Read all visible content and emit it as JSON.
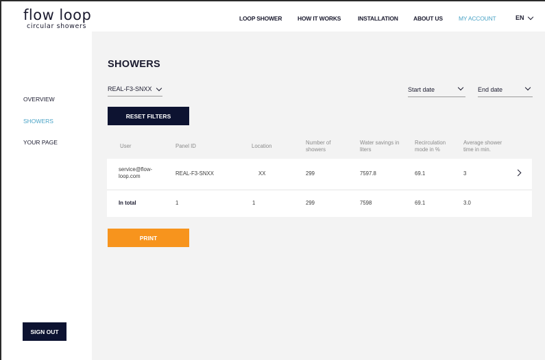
{
  "header": {
    "logo_main": "flow loop",
    "logo_sub": "circular showers",
    "nav": [
      {
        "label": "LOOP SHOWER"
      },
      {
        "label": "HOW IT WORKS"
      },
      {
        "label": "INSTALLATION"
      },
      {
        "label": "ABOUT US"
      },
      {
        "label": "MY ACCOUNT"
      }
    ],
    "lang": "EN"
  },
  "sidebar": {
    "items": [
      {
        "label": "OVERVIEW"
      },
      {
        "label": "SHOWERS"
      },
      {
        "label": "YOUR PAGE"
      }
    ],
    "signout_label": "SIGN OUT"
  },
  "main": {
    "title": "SHOWERS",
    "panel_select": "REAL-F3-SNXX",
    "start_date": "Start date",
    "end_date": "End date",
    "reset_label": "RESET FILTERS",
    "print_label": "PRINT",
    "table": {
      "headers": [
        "User",
        "Panel ID",
        "Location",
        "Number of showers",
        "Water savings in liters",
        "Recirculation mode in %",
        "Average shower time in min."
      ],
      "rows": [
        [
          "service@flow-loop.com",
          "REAL-F3-SNXX",
          "XX",
          "299",
          "7597.8",
          "69.1",
          "3"
        ]
      ],
      "total": [
        "In total",
        "1",
        "1",
        "299",
        "7598",
        "69.1",
        "3.0"
      ]
    }
  },
  "colors": {
    "navy": "#0d1331",
    "accent_blue": "#4aa3c6",
    "orange": "#f7941d",
    "content_bg": "#f3f3f3"
  }
}
